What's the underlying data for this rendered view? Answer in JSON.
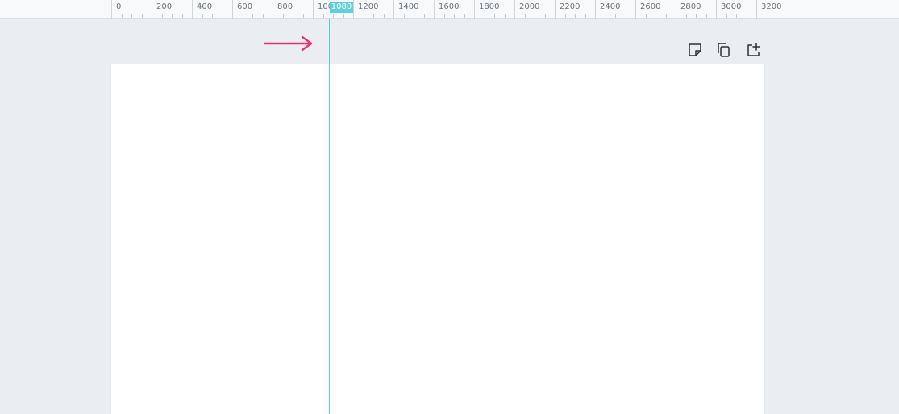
{
  "ruler": {
    "labels": [
      "0",
      "200",
      "400",
      "600",
      "800",
      "100",
      "1200",
      "1400",
      "1600",
      "1800",
      "2000",
      "2200",
      "2400",
      "2600",
      "2800",
      "3000",
      "3200"
    ],
    "guide_value": "1080"
  },
  "page_toolbar": {
    "icons": [
      "add-note-icon",
      "duplicate-page-icon",
      "add-page-icon"
    ]
  },
  "colors": {
    "guide": "#5fcad6",
    "arrow": "#e8336f",
    "canvas": "#ebeef1"
  }
}
